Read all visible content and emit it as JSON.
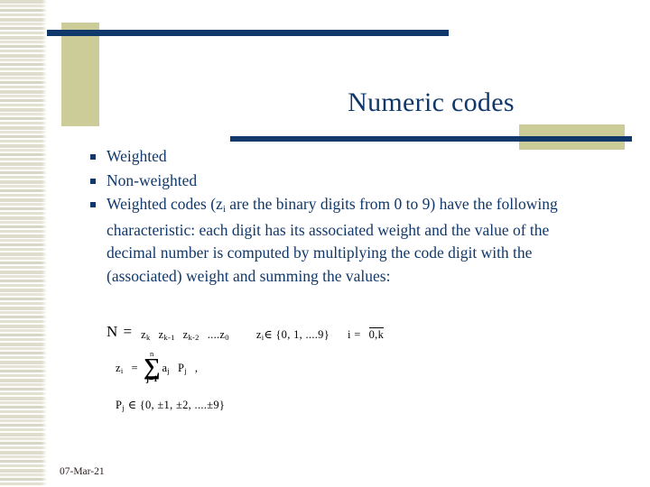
{
  "slide": {
    "title": "Numeric codes",
    "date": "07-Mar-21"
  },
  "colors": {
    "navy": "#11386b",
    "tan": "#cccc99",
    "stripe": "#dedccd",
    "background": "#ffffff"
  },
  "bullets": [
    {
      "marker": "square-bullet",
      "parts": [
        {
          "type": "text",
          "value": "Weighted"
        }
      ]
    },
    {
      "marker": "square-bullet",
      "parts": [
        {
          "type": "text",
          "value": "Non-weighted"
        }
      ]
    },
    {
      "marker": "square-bullet",
      "parts": [
        {
          "type": "text",
          "value": "Weighted codes (z"
        },
        {
          "type": "sub",
          "value": "i"
        },
        {
          "type": "text",
          "value": " are the binary digits from 0 to 9) have the following characteristic: each digit has its associated weight and the value of the decimal number is computed by multiplying the code digit with the (associated) weight and summing the values:"
        }
      ]
    }
  ],
  "bullet_text": {
    "b0": "Weighted",
    "b1": "Non-weighted",
    "b2_pre": "Weighted codes (z",
    "b2_sub": "i",
    "b2_post": " are the binary digits from 0 to 9) have the following characteristic: each digit has its associated weight and the value of the decimal number is computed by multiplying the code digit with the (associated) weight and summing the values:"
  },
  "formula": {
    "line1": {
      "lhs_N": "N =",
      "z_k": "z",
      "z_k_sub": "k",
      "z_k1": "z",
      "z_k1_sub": "k-1",
      "z_k2": "z",
      "z_k2_sub": "k-2",
      "ellipsis": "....z",
      "z_0_sub": "0",
      "zi": "z",
      "zi_sub": "i",
      "member": "∈ {0,  1,  ....9}",
      "i_eq": "i =",
      "range": "0,k"
    },
    "line2": {
      "zi": "z",
      "zi_sub": "i",
      "eq": "=",
      "sum_top": "n",
      "sum_glyph": "∑",
      "sum_bottom": "j=1",
      "term_a": "a",
      "term_a_sub": "j",
      "term_p": "P",
      "term_p_sub": "j",
      "comma": ","
    },
    "line3": {
      "p": "P",
      "p_sub": "j",
      "set": "∈ {0, ±1, ±2, ....±9}"
    }
  }
}
